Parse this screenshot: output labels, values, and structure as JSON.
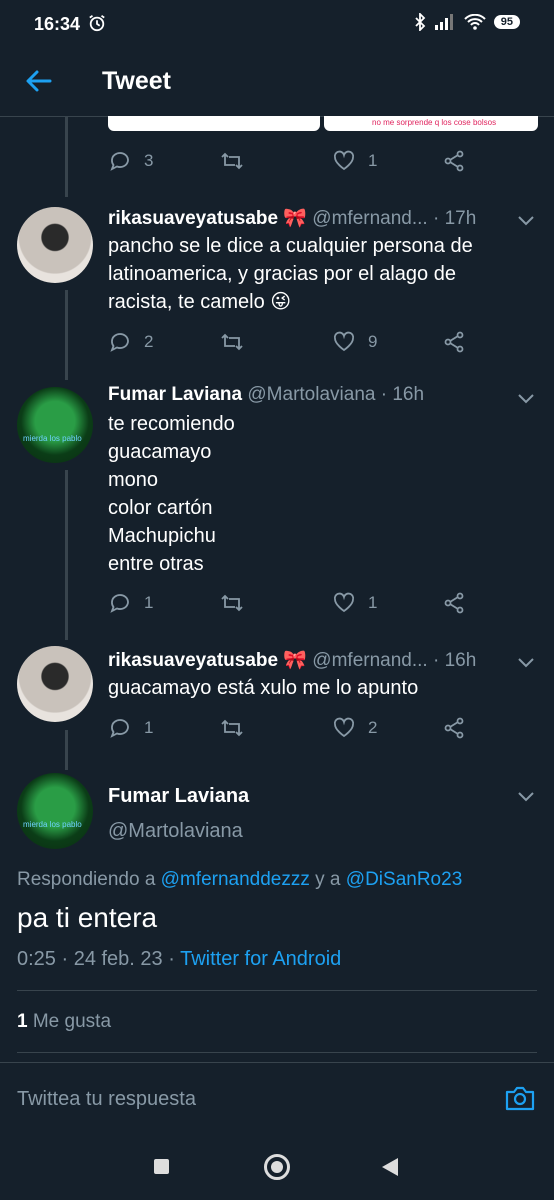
{
  "status_bar": {
    "time": "16:34",
    "battery": "95"
  },
  "header": {
    "title": "Tweet"
  },
  "card_fragment": {
    "text": "no me sorprende q los cose bolsos"
  },
  "tweets": [
    {
      "reply": "3",
      "retweet": "",
      "like": "1"
    },
    {
      "name": "rikasuaveyatusabe",
      "name_emoji": "🎀",
      "handle": "@mfernand...",
      "time": "· 17h",
      "lines": [
        "pancho se le dice a cualquier persona de",
        "latinoamerica, y gracias por el alago de",
        "racista, te camelo 😜"
      ],
      "reply": "2",
      "retweet": "",
      "like": "9"
    },
    {
      "name": "Fumar Laviana",
      "handle": "@Martolaviana",
      "time": "· 16h",
      "lines": [
        "te recomiendo",
        "guacamayo",
        "mono",
        "color cartón",
        "Machupichu",
        "entre otras"
      ],
      "reply": "1",
      "retweet": "",
      "like": "1"
    },
    {
      "name": "rikasuaveyatusabe",
      "name_emoji": "🎀",
      "handle": "@mfernand...",
      "time": "· 16h",
      "lines": [
        "guacamayo está xulo me lo apunto"
      ],
      "reply": "1",
      "retweet": "",
      "like": "2"
    }
  ],
  "avatar_tag": "mierda los pablo",
  "main_tweet": {
    "name": "Fumar Laviana",
    "handle": "@Martolaviana",
    "replying_prefix": "Respondiendo a",
    "replying_user1": "@mfernanddezzz",
    "replying_and": "y a",
    "replying_user2": "@DiSanRo23",
    "text": "pa ti entera",
    "datetime": "0:25 · 24 feb. 23 ·",
    "client": "Twitter for Android",
    "likes_count": "1",
    "likes_label": "Me gusta"
  },
  "reply_bar": {
    "placeholder": "Twittea tu respuesta"
  },
  "colors": {
    "background": "#15202b",
    "accent": "#1da1f2",
    "muted": "#8899a6",
    "divider": "#38444d"
  }
}
